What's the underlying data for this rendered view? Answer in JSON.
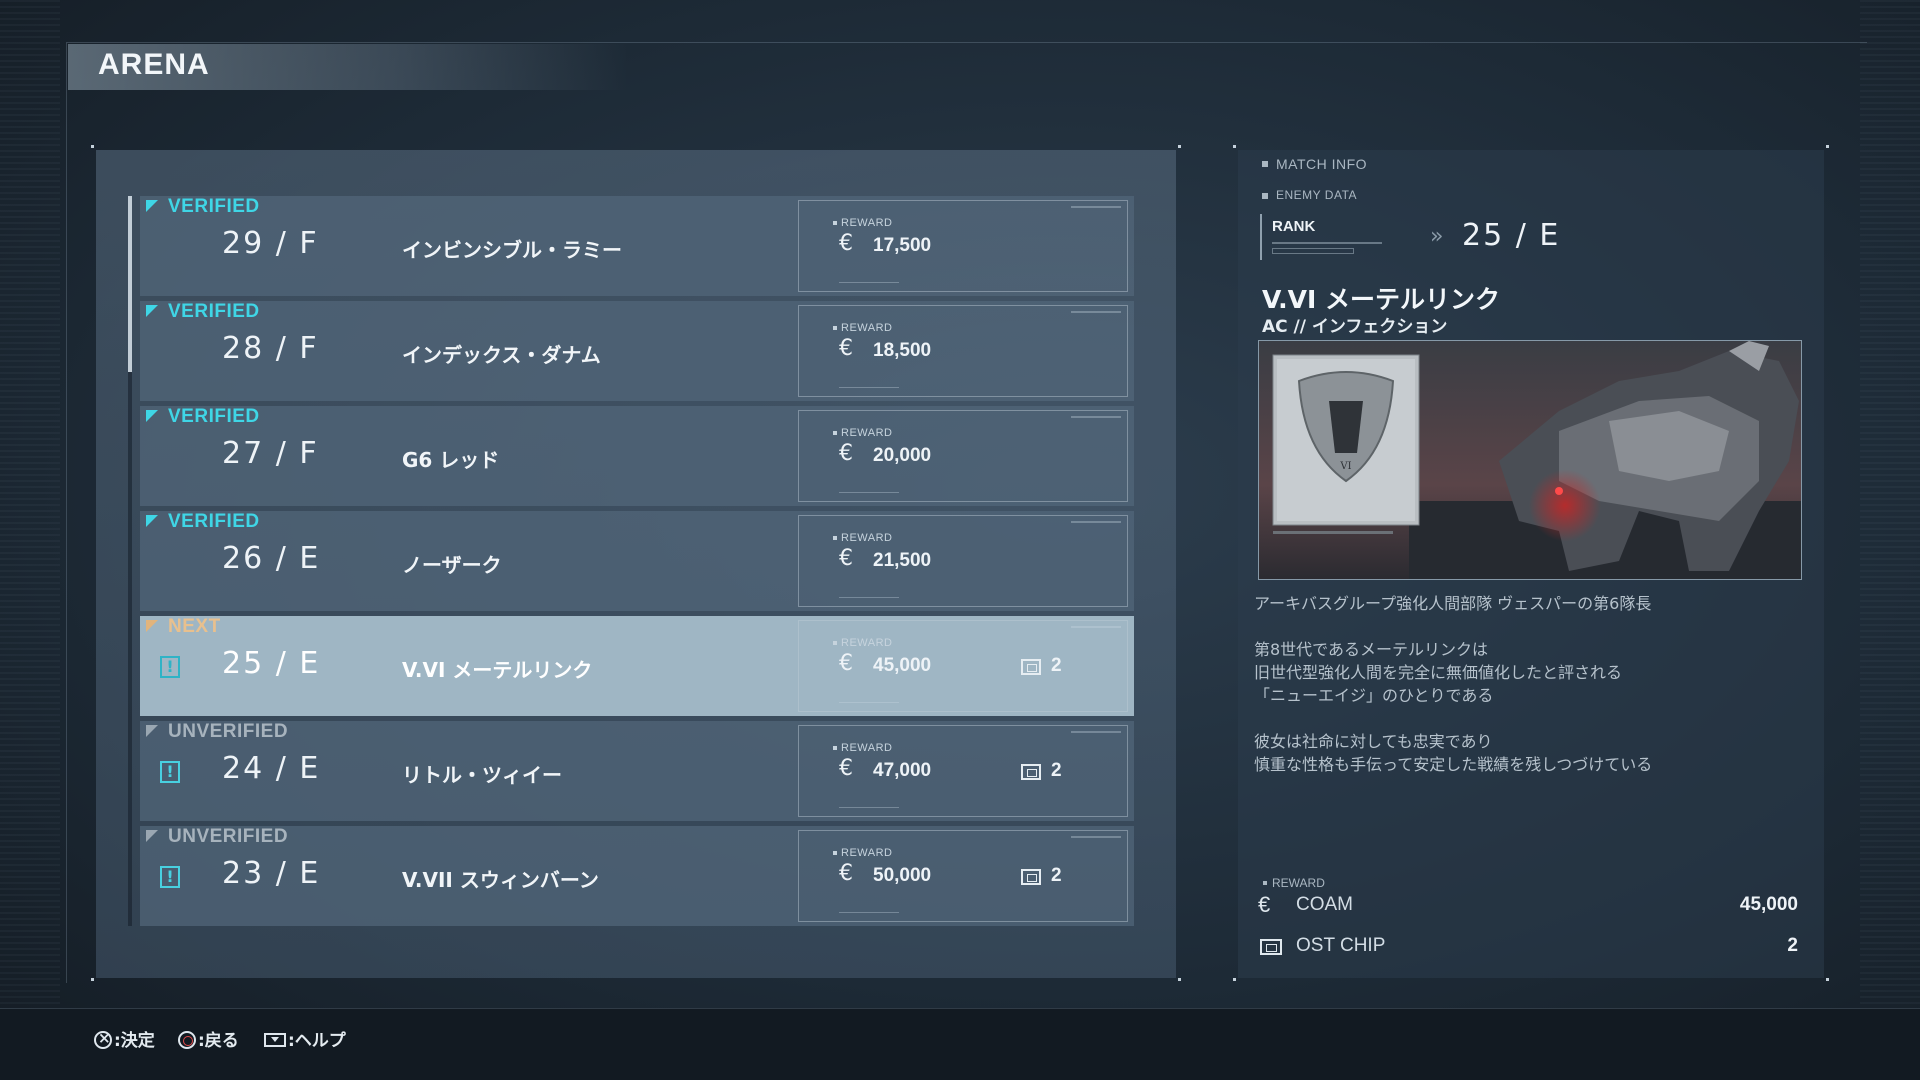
{
  "header": {
    "title": "ARENA"
  },
  "matches": [
    {
      "status": "VERIFIED",
      "rank": "29 / F",
      "opponent": "インビンシブル・ラミー",
      "reward_label": "REWARD",
      "reward": "17,500",
      "chips": ""
    },
    {
      "status": "VERIFIED",
      "rank": "28 / F",
      "opponent": "インデックス・ダナム",
      "reward_label": "REWARD",
      "reward": "18,500",
      "chips": ""
    },
    {
      "status": "VERIFIED",
      "rank": "27 / F",
      "opponent": "G6 レッド",
      "reward_label": "REWARD",
      "reward": "20,000",
      "chips": ""
    },
    {
      "status": "VERIFIED",
      "rank": "26 / E",
      "opponent": "ノーザーク",
      "reward_label": "REWARD",
      "reward": "21,500",
      "chips": ""
    },
    {
      "status": "NEXT",
      "rank": "25 / E",
      "opponent": "V.VI メーテルリンク",
      "reward_label": "REWARD",
      "reward": "45,000",
      "chips": "2"
    },
    {
      "status": "UNVERIFIED",
      "rank": "24 / E",
      "opponent": "リトル・ツィイー",
      "reward_label": "REWARD",
      "reward": "47,000",
      "chips": "2"
    },
    {
      "status": "UNVERIFIED",
      "rank": "23 / E",
      "opponent": "V.VII スウィンバーン",
      "reward_label": "REWARD",
      "reward": "50,000",
      "chips": "2"
    }
  ],
  "info": {
    "match_info_label": "MATCH INFO",
    "enemy_data_label": "ENEMY DATA",
    "rank_label": "RANK",
    "rank_value": "25 / E",
    "name": "V.VI メーテルリンク",
    "ac": "AC // インフェクション",
    "description_1": "アーキバスグループ強化人間部隊 ヴェスパーの第6隊長",
    "description_2": [
      "第8世代であるメーテルリンクは",
      "旧世代型強化人間を完全に無価値化したと評される",
      "「ニューエイジ」のひとりである"
    ],
    "description_3": [
      "彼女は社命に対しても忠実であり",
      "慎重な性格も手伝って安定した戦績を残しつづけている"
    ],
    "reward_label": "REWARD",
    "rewards": [
      {
        "icon": "coam-icon",
        "name": "COAM",
        "value": "45,000"
      },
      {
        "icon": "ost-chip-icon",
        "name": "OST CHIP",
        "value": "2"
      }
    ]
  },
  "footer": {
    "confirm": ":決定",
    "back": ":戻る",
    "help": ":ヘルプ"
  },
  "colors": {
    "verified": "#3fd6e6",
    "next": "#e8c08e",
    "unverified": "#a7b3bd",
    "selected_row": "#9fb6c4"
  }
}
